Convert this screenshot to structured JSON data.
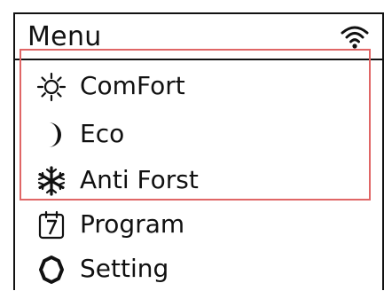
{
  "menu": {
    "title": "Menu",
    "wifi_icon": "wifi-icon",
    "highlight_color": "#e06666",
    "items": [
      {
        "label": "ComFort",
        "icon": "sun-icon"
      },
      {
        "label": "Eco",
        "icon": "moon-icon"
      },
      {
        "label": "Anti Forst",
        "icon": "snowflake-icon"
      },
      {
        "label": "Program",
        "icon": "calendar-icon"
      },
      {
        "label": "Setting",
        "icon": "gear-icon"
      }
    ]
  }
}
